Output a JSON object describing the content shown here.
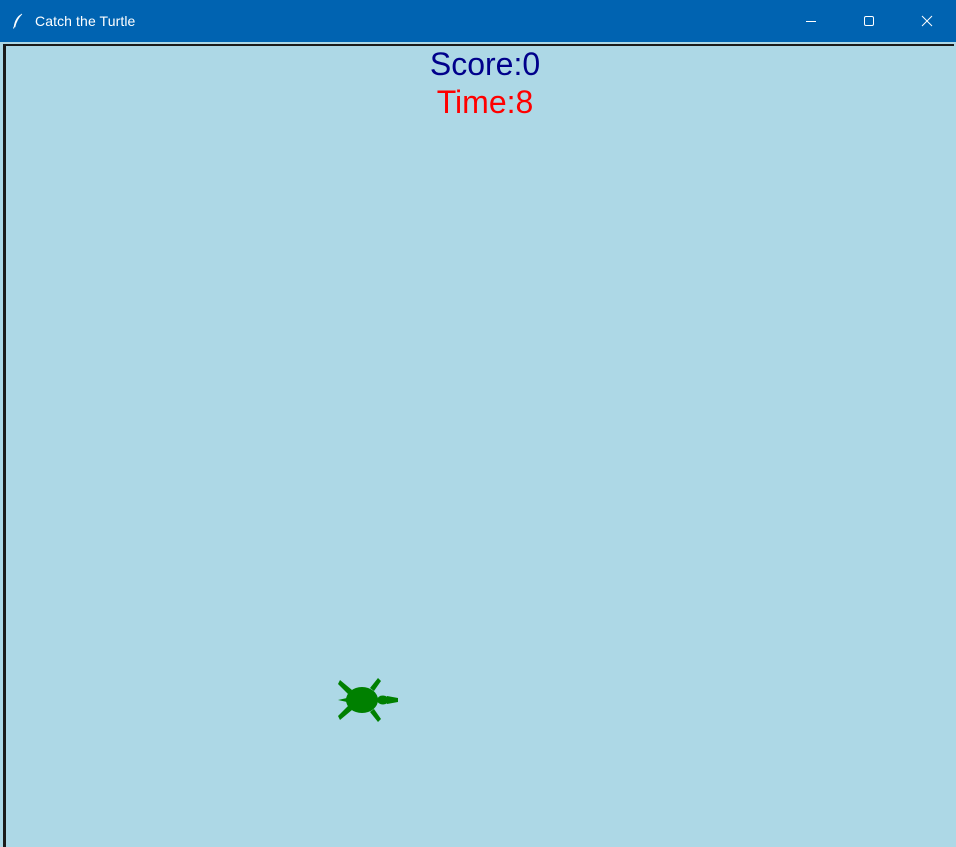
{
  "window": {
    "title": "Catch the Turtle",
    "app_icon": "feather-icon",
    "controls": [
      "minimize-icon",
      "maximize-icon",
      "close-icon"
    ]
  },
  "game": {
    "score_text": "Score:0",
    "time_text": "Time:8",
    "background_color": "#add8e6",
    "score_color": "#00008b",
    "time_color": "#ff0000",
    "turtle_color": "#008000",
    "turtle_icon": "turtle-icon"
  }
}
